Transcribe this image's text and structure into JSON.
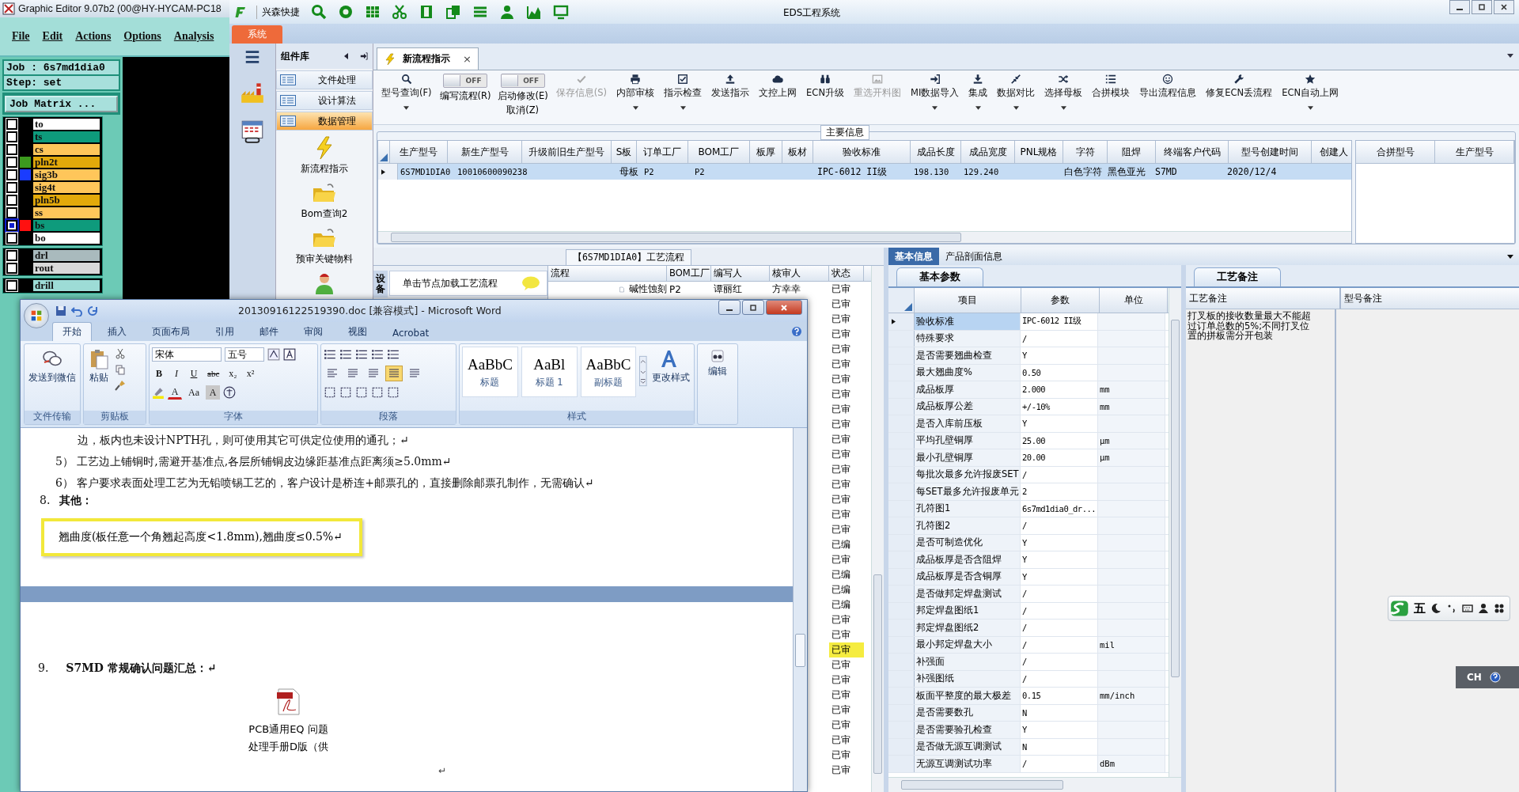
{
  "graphic_editor": {
    "title": "Graphic Editor 9.07b2 (00@HY-HYCAM-PC18",
    "menu": [
      "File",
      "Edit",
      "Actions",
      "Options",
      "Analysis"
    ],
    "job": "Job : 6s7md1dia0",
    "step": "Step: set",
    "job_matrix_button": "Job Matrix ...",
    "layer_groups": [
      {
        "layers": [
          {
            "name": "to",
            "color": "#ffffff",
            "selected": false
          },
          {
            "name": "ts",
            "color": "#0e9b7c",
            "selected": false
          },
          {
            "name": "cs",
            "color": "#ffc65a",
            "selected": false
          },
          {
            "name": "pln2t",
            "color": "#e3a90a",
            "swatch": {
              "color": "#3c9a1e"
            },
            "selected": false
          },
          {
            "name": "sig3b",
            "color": "#ffc65a",
            "swatch": {
              "color": "#1a3cff"
            },
            "selected": false
          },
          {
            "name": "sig4t",
            "color": "#ffc65a",
            "selected": false
          },
          {
            "name": "pln5b",
            "color": "#e3a90a",
            "selected": false
          },
          {
            "name": "ss",
            "color": "#ffc65a",
            "selected": false
          },
          {
            "name": "bs",
            "color": "#0e9b7c",
            "swatch": {
              "color": "#ff1010"
            },
            "selected": true
          },
          {
            "name": "bo",
            "color": "#ffffff",
            "selected": false
          }
        ]
      },
      {
        "layers": [
          {
            "name": "drl",
            "color": "#a9babd",
            "selected": false
          },
          {
            "name": "rout",
            "color": "#d9d9d9",
            "selected": false
          }
        ]
      },
      {
        "layers": [
          {
            "name": "drill",
            "color": "#9ddcd6",
            "selected": false
          }
        ]
      }
    ]
  },
  "eds": {
    "quick_label": "兴森快捷",
    "title": "EDS工程系统",
    "system_tab": "系统",
    "component_library": {
      "title": "组件库",
      "items": [
        {
          "label": "文件处理",
          "selected": false
        },
        {
          "label": "设计算法",
          "selected": false
        },
        {
          "label": "数据管理",
          "selected": true
        }
      ],
      "shortcuts": [
        {
          "kind": "lightning",
          "label": "新流程指示"
        },
        {
          "kind": "folder",
          "label": "Bom查询2"
        },
        {
          "kind": "folder",
          "label": "预审关键物料"
        },
        {
          "kind": "person"
        }
      ]
    },
    "doc_tab": {
      "label": "新流程指示",
      "close": "×"
    },
    "toolbar": [
      {
        "kind": "button",
        "label": "型号查询(F)",
        "dropdown": true,
        "disabled": false
      },
      {
        "kind": "toggle",
        "label": "编写流程(R)",
        "toggle_text": "OFF",
        "on": false
      },
      {
        "kind": "toggle",
        "label": "启动修改(E)",
        "sublabel": "取消(Z)",
        "toggle_text": "OFF",
        "on": false
      },
      {
        "kind": "button",
        "label": "保存信息(S)",
        "dropdown": false,
        "disabled": true
      },
      {
        "kind": "button",
        "label": "内部审核",
        "dropdown": true,
        "disabled": false
      },
      {
        "kind": "button",
        "label": "指示检查",
        "dropdown": true,
        "disabled": false
      },
      {
        "kind": "button",
        "label": "发送指示",
        "dropdown": false,
        "disabled": false
      },
      {
        "kind": "button",
        "label": "文控上网",
        "dropdown": false,
        "disabled": false
      },
      {
        "kind": "button",
        "label": "ECN升级",
        "dropdown": false,
        "disabled": false
      },
      {
        "kind": "button",
        "label": "重选开料图",
        "dropdown": false,
        "disabled": true
      },
      {
        "kind": "button",
        "label": "MI数据导入",
        "dropdown": true,
        "disabled": false
      },
      {
        "kind": "button",
        "label": "集成",
        "dropdown": true,
        "disabled": false
      },
      {
        "kind": "button",
        "label": "数据对比",
        "dropdown": true,
        "disabled": false
      },
      {
        "kind": "button",
        "label": "选择母板",
        "dropdown": true,
        "disabled": false
      },
      {
        "kind": "button",
        "label": "合拼模块",
        "dropdown": false,
        "disabled": false
      },
      {
        "kind": "button",
        "label": "导出流程信息",
        "dropdown": false,
        "disabled": false
      },
      {
        "kind": "button",
        "label": "修复ECN丢流程",
        "dropdown": false,
        "disabled": false
      },
      {
        "kind": "button",
        "label": "ECN自动上网",
        "dropdown": true,
        "disabled": false
      }
    ],
    "main_info": {
      "title": "主要信息",
      "columns": [
        "生产型号",
        "新生产型号",
        "升级前旧生产型号",
        "S板",
        "订单工厂",
        "BOM工厂",
        "板厚",
        "板材",
        "验收标准",
        "成品长度",
        "成品宽度",
        "PNL规格",
        "字符",
        "阻焊",
        "终端客户代码",
        "型号创建时间",
        "创建人"
      ],
      "rows": [
        {
          "selected": true,
          "cells": [
            "6S7MD1DIA0",
            "10010600090238",
            null,
            "母板",
            "P2",
            "P2",
            null,
            null,
            "IPC-6012 II级",
            "198.130",
            "129.240",
            null,
            "白色字符",
            "黑色亚光",
            "S7MD",
            "2020/12/4",
            null
          ]
        }
      ]
    },
    "merge_table": {
      "columns": [
        "合拼型号",
        "生产型号"
      ]
    },
    "process": {
      "title": "【6S7MD1DIA0】工艺流程",
      "side_tab": "设备",
      "hint": "单击节点加载工艺流程",
      "columns": [
        "流程",
        "BOM工厂",
        "编写人",
        "核审人",
        "状态"
      ],
      "rows": [
        {
          "step": "碱性蚀刻",
          "bom_factory": "P2",
          "writer": "谭丽红",
          "reviewer": "方幸幸",
          "status": "已审",
          "selected": false
        },
        {
          "status": "已审",
          "selected": false
        },
        {
          "status": "已审",
          "selected": false
        },
        {
          "status": "已审",
          "selected": false
        },
        {
          "status": "已审",
          "selected": false
        },
        {
          "status": "已审",
          "selected": false
        },
        {
          "status": "已审",
          "selected": false
        },
        {
          "status": "已审",
          "selected": false
        },
        {
          "status": "已审",
          "selected": false
        },
        {
          "status": "已审",
          "selected": false
        },
        {
          "status": "已审",
          "selected": false
        },
        {
          "status": "已审",
          "selected": false
        },
        {
          "status": "已审",
          "selected": false
        },
        {
          "status": "已审",
          "selected": false
        },
        {
          "status": "已审",
          "selected": false
        },
        {
          "status": "已审",
          "selected": false
        },
        {
          "status": "已审",
          "selected": false
        },
        {
          "status": "已编",
          "selected": false
        },
        {
          "status": "已审",
          "selected": false
        },
        {
          "status": "已编",
          "selected": false
        },
        {
          "status": "已编",
          "selected": false
        },
        {
          "status": "已编",
          "selected": false
        },
        {
          "status": "已审",
          "selected": false
        },
        {
          "status": "已审",
          "selected": false
        },
        {
          "status": "已审",
          "selected": true
        },
        {
          "status": "已审",
          "selected": false
        },
        {
          "status": "已审",
          "selected": false
        },
        {
          "status": "已审",
          "selected": false
        },
        {
          "status": "已审",
          "selected": false
        },
        {
          "status": "已审",
          "selected": false
        },
        {
          "status": "已审",
          "selected": false
        },
        {
          "status": "已审",
          "selected": false
        },
        {
          "status": "已审",
          "selected": false
        }
      ]
    },
    "info_tabs": [
      {
        "label": "基本信息",
        "selected": true
      },
      {
        "label": "产品剖面信息",
        "selected": false
      }
    ],
    "params": {
      "tab": "基本参数",
      "columns": [
        "项目",
        "参数",
        "单位"
      ],
      "rows": [
        {
          "item": "验收标准",
          "value": "IPC-6012 II级",
          "selected": true
        },
        {
          "item": "特殊要求",
          "value": "/",
          "selected": false
        },
        {
          "item": "是否需要翘曲检查",
          "value": "Y",
          "selected": false
        },
        {
          "item": "最大翘曲度%",
          "value": "0.50",
          "selected": false
        },
        {
          "item": "成品板厚",
          "value": "2.000",
          "unit": "mm",
          "selected": false
        },
        {
          "item": "成品板厚公差",
          "value": "+/-10%",
          "unit": "mm",
          "selected": false
        },
        {
          "item": "是否入库前压板",
          "value": "Y",
          "selected": false
        },
        {
          "item": "平均孔壁铜厚",
          "value": "25.00",
          "unit": "μm",
          "selected": false
        },
        {
          "item": "最小孔壁铜厚",
          "value": "20.00",
          "unit": "μm",
          "selected": false
        },
        {
          "item": "每批次最多允许报废SET",
          "value": "/",
          "selected": false
        },
        {
          "item": "每SET最多允许报废单元",
          "value": "2",
          "selected": false
        },
        {
          "item": "孔符图1",
          "value": "6s7md1dia0_dr...",
          "selected": false
        },
        {
          "item": "孔符图2",
          "value": "/",
          "selected": false
        },
        {
          "item": "是否可制造优化",
          "value": "Y",
          "selected": false
        },
        {
          "item": "成品板厚是否含阻焊",
          "value": "Y",
          "selected": false
        },
        {
          "item": "成品板厚是否含铜厚",
          "value": "Y",
          "selected": false
        },
        {
          "item": "是否做邦定焊盘测试",
          "value": "/",
          "selected": false
        },
        {
          "item": "邦定焊盘图纸1",
          "value": "/",
          "selected": false
        },
        {
          "item": "邦定焊盘图纸2",
          "value": "/",
          "selected": false
        },
        {
          "item": "最小邦定焊盘大小",
          "value": "/",
          "unit": "mil",
          "selected": false
        },
        {
          "item": "补强面",
          "value": "/",
          "selected": false
        },
        {
          "item": "补强图纸",
          "value": "/",
          "selected": false
        },
        {
          "item": "板面平整度的最大极差",
          "value": "0.15",
          "unit": "mm/inch",
          "selected": false
        },
        {
          "item": "是否需要数孔",
          "value": "N",
          "selected": false
        },
        {
          "item": "是否需要验孔检查",
          "value": "Y",
          "selected": false
        },
        {
          "item": "是否做无源互调测试",
          "value": "N",
          "selected": false
        },
        {
          "item": "无源互调测试功率",
          "value": "/",
          "unit": "dBm",
          "selected": false
        }
      ]
    },
    "remarks": {
      "tab": "工艺备注",
      "columns": [
        "工艺备注",
        "型号备注"
      ],
      "note": "打叉板的接收数量最大不能超过订单总数的5%;不同打叉位置的拼板需分开包装"
    }
  },
  "word": {
    "title": "20130916122519390.doc [兼容模式] - Microsoft Word",
    "tabs": [
      {
        "label": "开始",
        "selected": true
      },
      {
        "label": "插入",
        "selected": false
      },
      {
        "label": "页面布局",
        "selected": false
      },
      {
        "label": "引用",
        "selected": false
      },
      {
        "label": "邮件",
        "selected": false
      },
      {
        "label": "审阅",
        "selected": false
      },
      {
        "label": "视图",
        "selected": false
      },
      {
        "label": "Acrobat",
        "selected": false
      }
    ],
    "ribbon": {
      "send_button": "发送到微信",
      "send_group": "文件传输",
      "paste_button": "粘贴",
      "clipboard_group": "剪贴板",
      "font": "宋体",
      "font_size": "五号",
      "font_buttons": [
        "B",
        "I",
        "U",
        "abc",
        "x₂",
        "x²"
      ],
      "font_buttons_2": [
        "A",
        "Aa",
        "A"
      ],
      "font_group": "字体",
      "alignment_buttons": [
        {
          "selected": false
        },
        {
          "selected": false
        },
        {
          "selected": false
        },
        {
          "selected": true
        },
        {
          "selected": false
        }
      ],
      "paragraph_group": "段落",
      "styles": [
        {
          "preview": "AaBbC",
          "label": "标题"
        },
        {
          "preview": "AaBl",
          "label": "标题 1"
        },
        {
          "preview": "AaBbC",
          "label": "副标题"
        }
      ],
      "change_styles": "更改样式",
      "styles_group": "样式",
      "edit_button": "编辑"
    },
    "document": {
      "lines": [
        {
          "text": "边，板内也未设计NPTH孔，则可使用其它可供定位使用的通孔；↵",
          "indent": true
        },
        {
          "text": "5）  工艺边上铺铜时,需避开基准点,各层所铺铜皮边缘距基准点距离须≥5.0mm↵",
          "indent": false
        },
        {
          "text": "6）  客户要求表面处理工艺为无铅喷锡工艺的，客户设计是桥连+邮票孔的，直接删除邮票孔制作，无需确认↵",
          "indent": false
        }
      ],
      "heading_8": {
        "number": "8.",
        "text": "其他："
      },
      "highlight": "翘曲度(板任意一个角翘起高度<1.8mm),翘曲度≤0.5%↵",
      "heading_9": {
        "number": "9.",
        "text": "S7MD 常规确认问题汇总：↵"
      },
      "attachment": [
        "PCB通用EQ 问题",
        "处理手册D版（供"
      ],
      "paragraph_mark": "↵"
    }
  },
  "ime": {
    "mode": "五"
  },
  "language_bar": {
    "label": "CH"
  }
}
